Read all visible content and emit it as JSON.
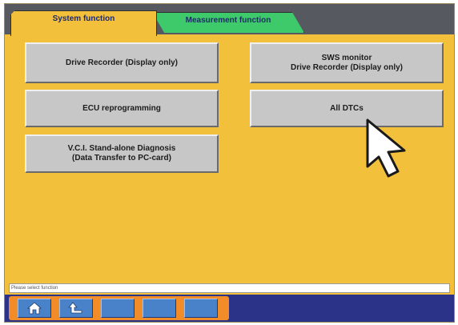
{
  "tabs": {
    "system": "System function",
    "measurement": "Measurement function"
  },
  "buttons": {
    "drive_recorder": "Drive Recorder (Display only)",
    "sws_monitor": "SWS monitor\nDrive Recorder (Display only)",
    "ecu_reprogramming": "ECU reprogramming",
    "all_dtcs": "All DTCs",
    "vci_standalone": "V.C.I. Stand-alone Diagnosis\n(Data Transfer to PC-card)"
  },
  "status": {
    "text": "Please select function"
  },
  "toolbar": {
    "items": [
      "home-icon",
      "back-icon",
      "blank",
      "blank",
      "blank"
    ]
  },
  "colors": {
    "background": "#f2c03a",
    "measurement_tab": "#3ec96a",
    "bottom_bar": "#2b3388",
    "toolbar": "#f28c28",
    "toolbar_button": "#4a82c9"
  }
}
